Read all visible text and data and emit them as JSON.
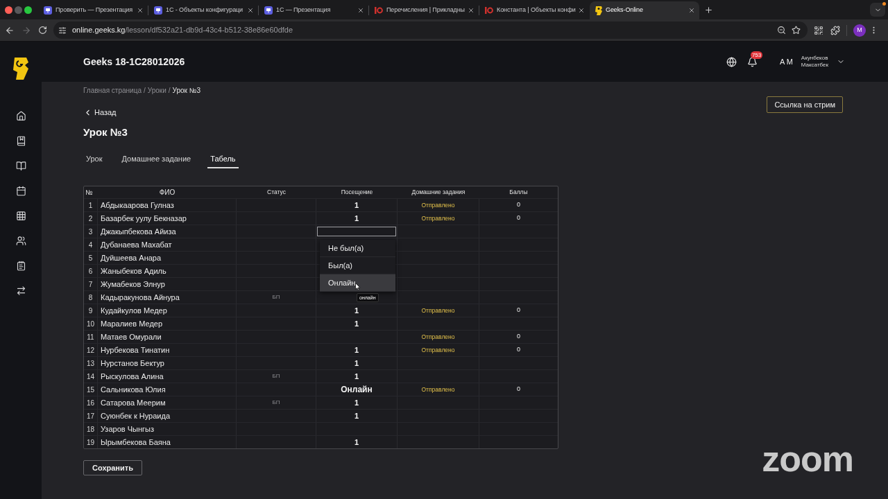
{
  "browser": {
    "tabs": [
      {
        "title": "Проверить — Презентация",
        "kind": "slides",
        "selected": false
      },
      {
        "title": "1С - Объекты конфигураци",
        "kind": "slides",
        "selected": false
      },
      {
        "title": "1С — Презентация",
        "kind": "slides",
        "selected": false
      },
      {
        "title": "Перечисления | Прикладны",
        "kind": "reference",
        "selected": false
      },
      {
        "title": "Константа | Объекты конфи",
        "kind": "reference",
        "selected": false
      },
      {
        "title": "Geeks-Online",
        "kind": "app",
        "selected": true
      }
    ],
    "forward_disabled": true,
    "url": {
      "host": "online.geeks.kg",
      "path": "/lesson/df532a21-db9d-43c4-b512-38e86e60dfde"
    },
    "profile_initial": "M"
  },
  "header": {
    "title": "Geeks 18-1C28012026",
    "notifications": "753",
    "user_initials": "A M",
    "user_name_lines": [
      "Акунбеков",
      "Максатбек"
    ]
  },
  "breadcrumbs": [
    {
      "kind": "link",
      "label": "Главная страница"
    },
    {
      "kind": "separator",
      "label": "/"
    },
    {
      "kind": "link",
      "label": "Уроки"
    },
    {
      "kind": "separator",
      "label": "/"
    },
    {
      "kind": "current",
      "label": "Урок №3"
    }
  ],
  "back_link": "Назад",
  "page_title": "Урок №3",
  "stream_button": "Ссылка на стрим",
  "tabs": [
    {
      "label": "Урок",
      "selected": false
    },
    {
      "label": "Домашнее задание",
      "selected": false
    },
    {
      "label": "Табель",
      "selected": true
    }
  ],
  "table": {
    "columns": [
      "№",
      "ФИО",
      "Статус",
      "Посещение",
      "Домашние задания",
      "Баллы"
    ],
    "rows": [
      {
        "number": "1",
        "name": "Абдыкаарова Гулназ",
        "attendance": {
          "kind": "mark",
          "value": "1"
        },
        "homework": "Отправлено",
        "score": "0"
      },
      {
        "number": "2",
        "name": "Базарбек уулу Бекназар",
        "attendance": {
          "kind": "mark",
          "value": "1"
        },
        "homework": "Отправлено",
        "score": "0"
      },
      {
        "number": "3",
        "name": "Джакыпбекова Айиза",
        "attendance": {
          "kind": "select",
          "expanded": true,
          "options": [
            {
              "label": "Не был(а)",
              "selected": false
            },
            {
              "label": "Был(а)",
              "selected": false
            },
            {
              "label": "Онлайн",
              "selected": true
            }
          ],
          "tooltip": "онлайн"
        }
      },
      {
        "number": "4",
        "name": "Дубанаева Махабат"
      },
      {
        "number": "5",
        "name": "Дуйшеева Анара"
      },
      {
        "number": "6",
        "name": "Жаныбеков Адиль"
      },
      {
        "number": "7",
        "name": "Жумабеков Элнур"
      },
      {
        "number": "8",
        "name": "Кадыракунова Айнура",
        "status": "БП"
      },
      {
        "number": "9",
        "name": "Кудайкулов Медер",
        "attendance": {
          "kind": "mark",
          "value": "1"
        },
        "homework": "Отправлено",
        "score": "0"
      },
      {
        "number": "10",
        "name": "Маралиев Медер",
        "attendance": {
          "kind": "mark",
          "value": "1"
        }
      },
      {
        "number": "11",
        "name": "Матаев Омурали",
        "homework": "Отправлено",
        "score": "0"
      },
      {
        "number": "12",
        "name": "Нурбекова Тинатин",
        "attendance": {
          "kind": "mark",
          "value": "1"
        },
        "homework": "Отправлено",
        "score": "0"
      },
      {
        "number": "13",
        "name": "Нурстанов Бектур",
        "attendance": {
          "kind": "mark",
          "value": "1"
        }
      },
      {
        "number": "14",
        "name": "Рыскулова Алина",
        "status": "БП",
        "attendance": {
          "kind": "mark",
          "value": "1"
        }
      },
      {
        "number": "15",
        "name": "Сальникова Юлия",
        "attendance": {
          "kind": "label",
          "value": "Онлайн"
        },
        "homework": "Отправлено",
        "score": "0"
      },
      {
        "number": "16",
        "name": "Сатарова Меерим",
        "status": "БП",
        "attendance": {
          "kind": "mark",
          "value": "1"
        }
      },
      {
        "number": "17",
        "name": "Суюнбек к Нураида",
        "attendance": {
          "kind": "mark",
          "value": "1"
        }
      },
      {
        "number": "18",
        "name": "Узаров Чынгыз"
      },
      {
        "number": "19",
        "name": "Ырымбекова Баяна",
        "attendance": {
          "kind": "mark",
          "value": "1"
        }
      }
    ]
  },
  "save_button": "Сохранить",
  "overlay_logo": "zoom"
}
